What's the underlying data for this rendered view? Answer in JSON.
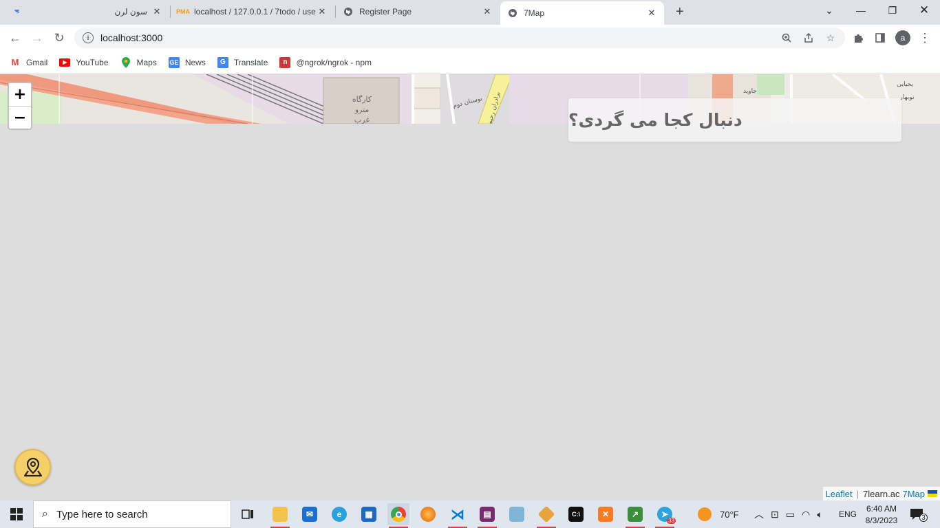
{
  "tabs": [
    {
      "title": "سون لرن",
      "favicon": "sevenlearn-icon"
    },
    {
      "title": "localhost / 127.0.0.1 / 7todo / use",
      "favicon": "phpmyadmin-icon"
    },
    {
      "title": "Register Page",
      "favicon": "globe-icon"
    },
    {
      "title": "7Map",
      "favicon": "globe-icon",
      "active": true
    }
  ],
  "address": {
    "url": "localhost:3000"
  },
  "profile_initial": "a",
  "bookmarks": [
    {
      "label": "Gmail",
      "icon": "gmail-icon",
      "color": "#ea4335",
      "glyph": "M"
    },
    {
      "label": "YouTube",
      "icon": "youtube-icon",
      "color": "#ff0000",
      "glyph": "▶"
    },
    {
      "label": "Maps",
      "icon": "maps-icon",
      "color": "#34a853",
      "glyph": "⚲"
    },
    {
      "label": "News",
      "icon": "news-icon",
      "color": "#4285f4",
      "glyph": "G"
    },
    {
      "label": "Translate",
      "icon": "translate-icon",
      "color": "#4285f4",
      "glyph": "G"
    },
    {
      "label": "@ngrok/ngrok - npm",
      "icon": "npm-icon",
      "color": "#cb3837",
      "glyph": "n"
    }
  ],
  "map": {
    "zoom_in": "+",
    "zoom_out": "−",
    "search_placeholder": "دنبال کجا می گردی؟",
    "attribution": {
      "leaflet": "Leaflet",
      "separator": "|",
      "prefix": "7learn.ac",
      "brand": "7Map"
    },
    "tile_labels": [
      "کارگاه",
      "مترو",
      "غرب",
      "بوستان دوم",
      "برادران رحیم",
      "جاوید",
      "یحیایی",
      "نوبهار"
    ]
  },
  "taskbar": {
    "search_placeholder": "Type here to search",
    "weather": "70°F",
    "language": "ENG",
    "time": "6:40 AM",
    "date": "8/3/2023",
    "notifications": "3",
    "telegram_badge": "33"
  }
}
